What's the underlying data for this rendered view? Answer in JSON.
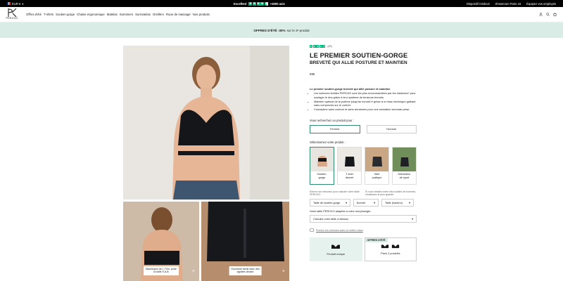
{
  "topbar": {
    "currency": "EUR €",
    "rating_label": "Excellent",
    "reviews": "+4000 avis",
    "links": [
      "Dispositif médical",
      "Showroom Paris 16",
      "Équipez vos employés"
    ]
  },
  "header": {
    "brand": "PERCKO",
    "nav": [
      "Offres d'été",
      "T-shirts",
      "Soutien-gorge",
      "Chaise ergonomique",
      "Matelas",
      "Sommiers",
      "Surmatelas",
      "Oreillers",
      "Roue de massage",
      "Nos produits"
    ]
  },
  "promo": {
    "bold": "OFFRES D'ÉTÉ -30%",
    "text": "sur le 2ᵉ produit"
  },
  "gallery": {
    "caption_a": [
      "Mannequin de 1,70m, porte",
      "la taille S A-B"
    ],
    "caption_b": [
      "Ouverture facile avec des",
      "agrafes devant"
    ]
  },
  "product": {
    "review_count": "(83)",
    "title": [
      "LE PREMIER SOUTIEN-GORGE"
    ],
    "subtitle": [
      "BREVETÉ QUI ALLIE POSTURE ET MAINTIEN"
    ],
    "price": "69€",
    "desc_intro": "Le premier soutien-gorge breveté qui allie posture et maintien",
    "bullets": [
      "Les sciences textiles PERCKO sont les plus recommandées par les médecins* pour soulager le dos grâce à leur système de tenseurs brevets.",
      "Maintien optimal de la poitrine jusqu'au bonnet H grâce à un tissu technique galbant, sans compromis sur le confort.",
      "Conception sans couture et sans armatures pour une sensation seconde-peau."
    ],
    "gender_question": "Vous recherchez un produit pour :",
    "gender_options": [
      "Femme",
      "Homme"
    ],
    "product_question": "Sélectionnez votre produit :",
    "products": [
      [
        "Soutien-",
        "gorge"
      ],
      [
        "T-shirt",
        "discret"
      ],
      [
        "Gilet",
        "pratique"
      ],
      [
        "Débardeur",
        "de sport"
      ]
    ],
    "size_hint_left": "Entrez vos mesures pour calculer votre taille PERCKO :",
    "size_hint_right": "Si vous hésitez entre deux tailles de bonnets, choisissez la plus grande.",
    "selects": [
      "Taille de soutien-gorge",
      "Bonnet",
      "Taille (hauteur)"
    ],
    "morph_label": "Votre taille PERCKO adaptée à votre morphologie :",
    "morph_select": "Calculez votre taille ci-dessus",
    "measure_tip": "Prenez vos mesures avec un mètre ruban",
    "offer_tag": "OFFRES D'ÉTÉ",
    "offers": [
      "Produit unique",
      "Pack 2 produits"
    ]
  },
  "colors": {
    "accent": "#2f8a73",
    "promo": "#d9ece6",
    "trustpilot": "#00b67a"
  }
}
